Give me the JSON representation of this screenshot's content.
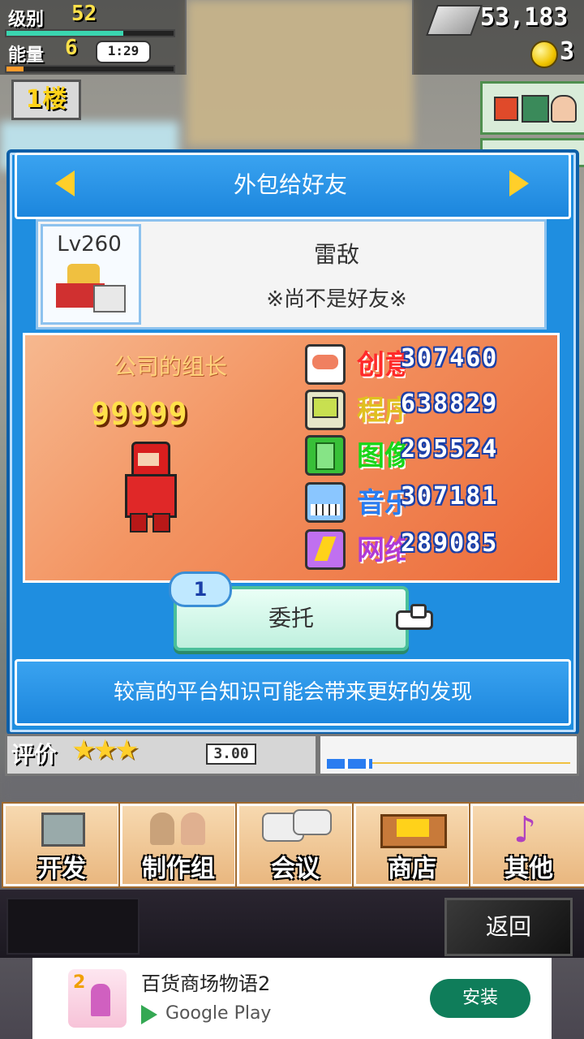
{
  "hud": {
    "level_label": "级别",
    "level_value": "52",
    "energy_label": "能量",
    "energy_value": "6",
    "timer": "1:29",
    "money": "53,183",
    "coins": "3"
  },
  "floor": {
    "label": "1楼"
  },
  "modal": {
    "title": "外包给好友",
    "friend": {
      "level": "Lv260",
      "name": "雷敌",
      "status": "※尚不是好友※"
    },
    "company_leader_label": "公司的组长",
    "total_value": "99999",
    "stats": [
      {
        "label": "创意",
        "value": "307460",
        "color": "#ff2a2a"
      },
      {
        "label": "程序",
        "value": "638829",
        "color": "#e0c020"
      },
      {
        "label": "图像",
        "value": "295524",
        "color": "#1ad61a"
      },
      {
        "label": "音乐",
        "value": "307181",
        "color": "#2a7df0"
      },
      {
        "label": "网络",
        "value": "289085",
        "color": "#b03ad6"
      }
    ],
    "delegate_count": "1",
    "delegate_label": "委托",
    "tip": "较高的平台知识可能会带来更好的发现"
  },
  "rating": {
    "label": "评价",
    "stars": "★★★",
    "value": "3.00"
  },
  "nav": [
    {
      "label": "开发",
      "icon": "monitor-icon"
    },
    {
      "label": "制作组",
      "icon": "team-icon"
    },
    {
      "label": "会议",
      "icon": "chat-icon"
    },
    {
      "label": "商店",
      "icon": "shop-icon"
    },
    {
      "label": "其他",
      "icon": "music-note-icon"
    }
  ],
  "back_label": "返回",
  "ad": {
    "title": "百货商场物语2",
    "store": "Google Play",
    "install_label": "安装"
  }
}
